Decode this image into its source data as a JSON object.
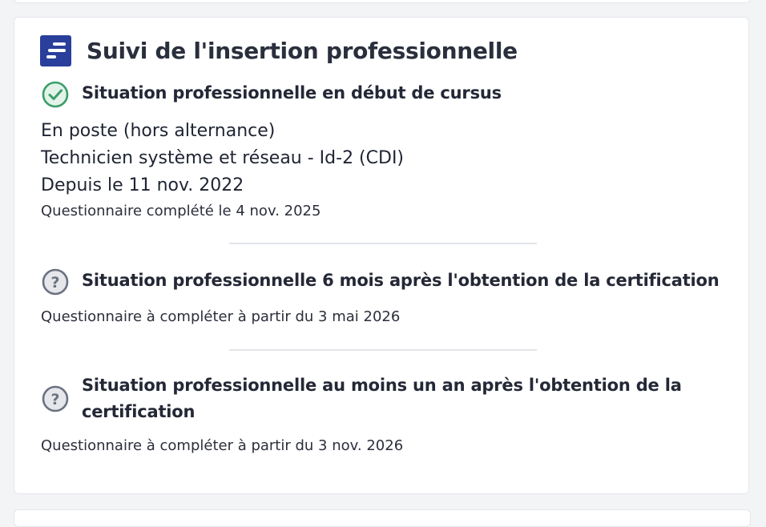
{
  "header": {
    "title": "Suivi de l'insertion professionnelle",
    "logo_icon": "list-doc-icon",
    "logo_color": "#2a3f9b"
  },
  "sections": [
    {
      "status_icon": "check-circle-icon",
      "status_color": "#3c9d6a",
      "title": "Situation professionnelle en début de cursus",
      "lines": [
        "En poste (hors alternance)",
        "Technicien système et réseau - Id-2 (CDI)",
        "Depuis le 11 nov. 2022"
      ],
      "note": "Questionnaire complété le 4 nov. 2025"
    },
    {
      "status_icon": "question-circle-icon",
      "status_color": "#6b7280",
      "title": "Situation professionnelle 6 mois après l'obtention de la certification",
      "note": "Questionnaire à compléter à partir du 3 mai 2026"
    },
    {
      "status_icon": "question-circle-icon",
      "status_color": "#6b7280",
      "title_line1": "Situation professionnelle au moins un an après l'obtention de la",
      "title_line2": "certification",
      "note": "Questionnaire à compléter à partir du 3 nov. 2026"
    }
  ]
}
